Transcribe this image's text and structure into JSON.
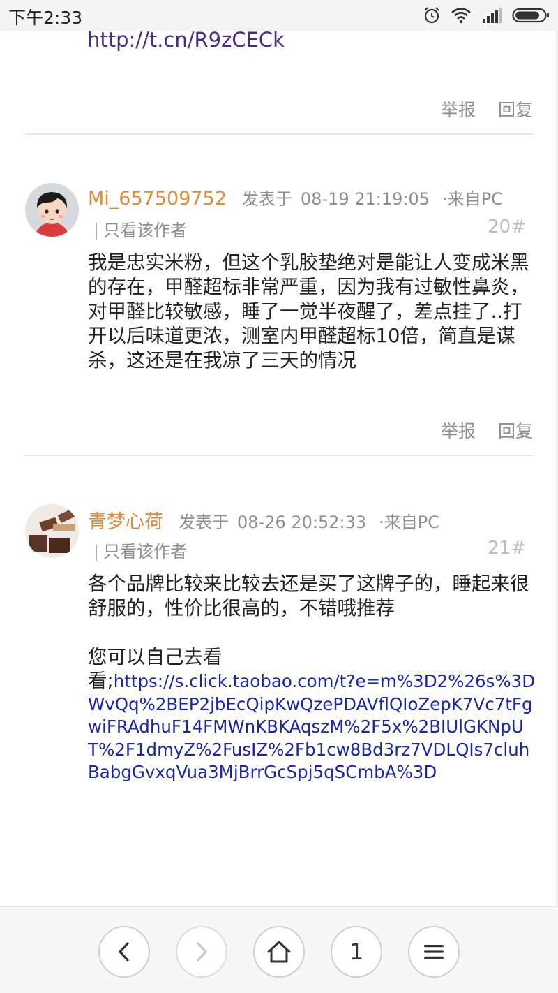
{
  "status_bar": {
    "time": "下午2:33"
  },
  "top_link": "http://t.cn/R9zCECk",
  "actions": {
    "report": "举报",
    "reply": "回复"
  },
  "posts": [
    {
      "username": "Mi_657509752",
      "posted_label": "发表于",
      "datetime": "08-19 21:19:05",
      "source": "·来自PC",
      "only_author_label": "只看该作者",
      "floor": "20#",
      "body": "我是忠实米粉，但这个乳胶垫绝对是能让人变成米黑的存在，甲醛超标非常严重，因为我有过敏性鼻炎，对甲醛比较敏感，睡了一觉半夜醒了，差点挂了..打开以后味道更浓，测室内甲醛超标10倍，简直是谋杀，这还是在我凉了三天的情况"
    },
    {
      "username": "青梦心荷",
      "posted_label": "发表于",
      "datetime": "08-26 20:52:33",
      "source": "·来自PC",
      "only_author_label": "只看该作者",
      "floor": "21#",
      "body": "各个品牌比较来比较去还是买了这牌子的，睡起来很舒服的，性价比很高的，不错哦推荐",
      "body_line2": "您可以自己去看",
      "link_prefix": "看;",
      "link": "https://s.click.taobao.com/t?e=m%3D2%26s%3DWvQq%2BEP2jbEcQipKwQzePDAVflQIoZepK7Vc7tFgwiFRAdhuF14FMWnKBKAqszM%2F5x%2BIUlGKNpUT%2F1dmyZ%2FusIZ%2Fb1cw8Bd3rz7VDLQIs7cluhBabgGvxqVua3MjBrrGcSpj5qSCmbA%3D"
    }
  ],
  "bottom_nav": {
    "page": "1",
    "icons": [
      "back-icon",
      "forward-icon",
      "home-icon",
      "page-number",
      "menu-icon"
    ]
  }
}
